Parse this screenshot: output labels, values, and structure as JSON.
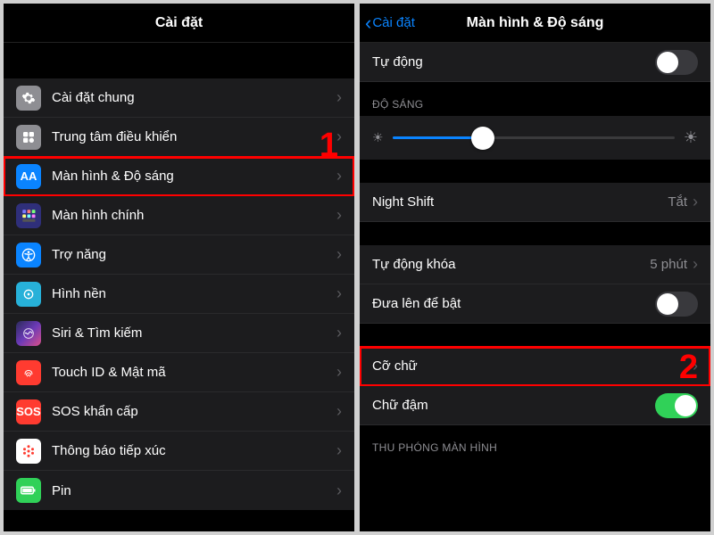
{
  "left": {
    "title": "Cài đặt",
    "items": [
      {
        "label": "Cài đặt chung",
        "icon": "gear-icon"
      },
      {
        "label": "Trung tâm điều khiển",
        "icon": "control-center-icon"
      },
      {
        "label": "Màn hình & Độ sáng",
        "icon": "display-icon",
        "highlight": true
      },
      {
        "label": "Màn hình chính",
        "icon": "home-screen-icon"
      },
      {
        "label": "Trợ năng",
        "icon": "accessibility-icon"
      },
      {
        "label": "Hình nền",
        "icon": "wallpaper-icon"
      },
      {
        "label": "Siri & Tìm kiếm",
        "icon": "siri-icon"
      },
      {
        "label": "Touch ID & Mật mã",
        "icon": "touchid-icon"
      },
      {
        "label": "SOS khẩn cấp",
        "icon": "sos-icon"
      },
      {
        "label": "Thông báo tiếp xúc",
        "icon": "exposure-icon"
      },
      {
        "label": "Pin",
        "icon": "battery-icon"
      }
    ]
  },
  "right": {
    "back": "Cài đặt",
    "title": "Màn hình & Độ sáng",
    "auto_label": "Tự động",
    "auto_on": false,
    "brightness_header": "ĐỘ SÁNG",
    "brightness_pct": 32,
    "night_shift_label": "Night Shift",
    "night_shift_value": "Tắt",
    "autolock_label": "Tự động khóa",
    "autolock_value": "5 phút",
    "raise_label": "Đưa lên để bật",
    "raise_on": false,
    "text_size_label": "Cỡ chữ",
    "bold_label": "Chữ đậm",
    "bold_on": true,
    "zoom_header": "THU PHÓNG MÀN HÌNH"
  },
  "callouts": {
    "one": "1",
    "two": "2"
  }
}
